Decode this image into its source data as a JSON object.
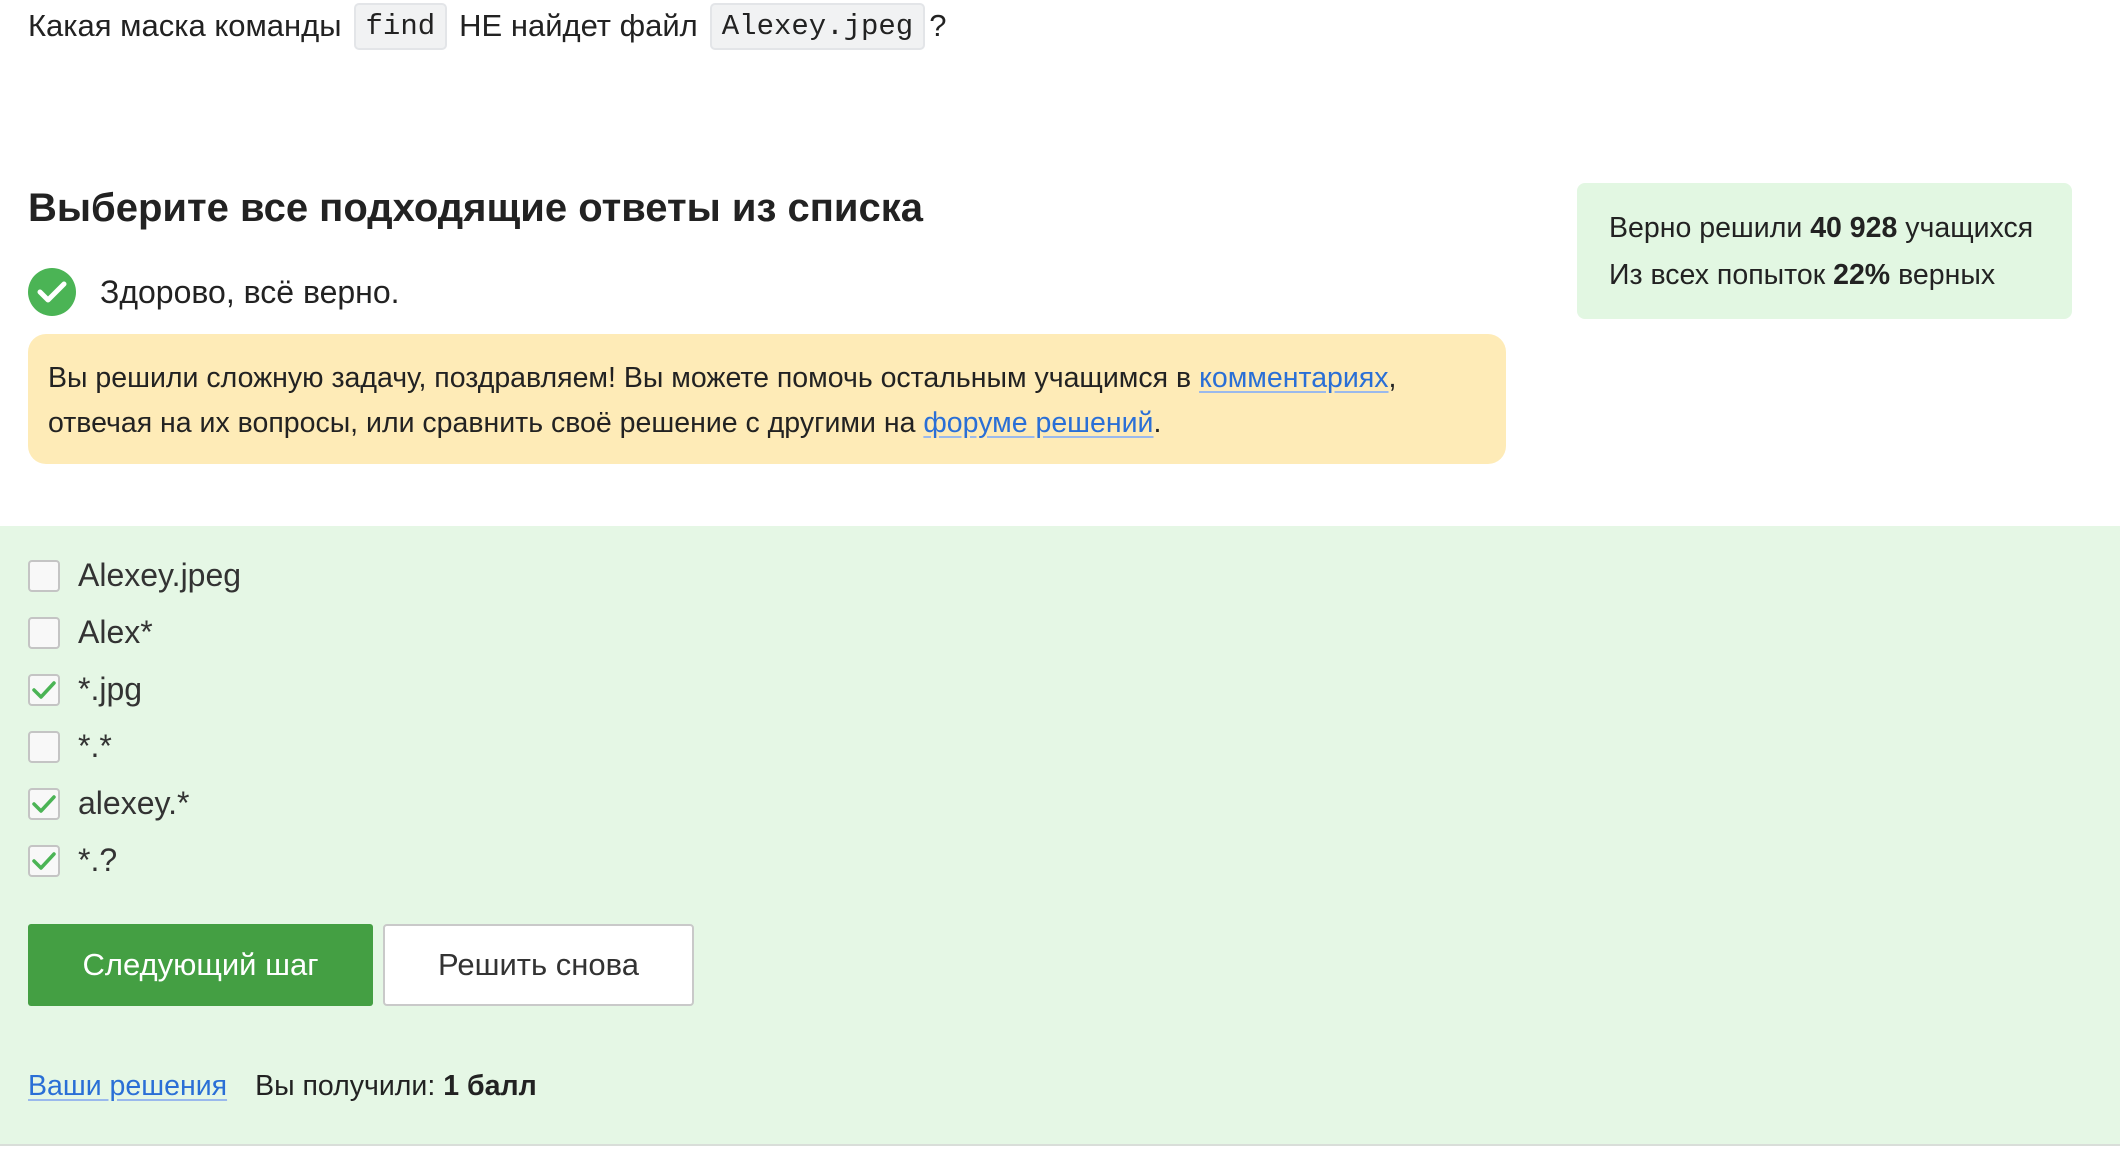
{
  "question": {
    "prefix": "Какая маска команды",
    "command": "find",
    "middle": "НЕ найдет файл",
    "filename": "Alexey.jpeg",
    "suffix": "?"
  },
  "heading": "Выберите все подходящие ответы из списка",
  "success_message": "Здорово, всё верно.",
  "notice": {
    "text_before": "Вы решили сложную задачу, поздравляем! Вы можете помочь остальным учащимся в ",
    "comments_link": "комментариях",
    "text_middle": ", отвечая на их вопросы, или сравнить своё решение с другими на ",
    "forum_link": "форуме решений",
    "text_after": "."
  },
  "stats": {
    "solved_prefix": "Верно решили",
    "solved_count": "40 928",
    "solved_suffix": "учащихся",
    "attempts_prefix": "Из всех попыток",
    "attempts_percent": "22%",
    "attempts_suffix": "верных"
  },
  "options": [
    {
      "label": "Alexey.jpeg",
      "checked": false
    },
    {
      "label": "Alex*",
      "checked": false
    },
    {
      "label": "*.jpg",
      "checked": true
    },
    {
      "label": "*.*",
      "checked": false
    },
    {
      "label": "alexey.*",
      "checked": true
    },
    {
      "label": "*.?",
      "checked": true
    }
  ],
  "buttons": {
    "next": "Следующий шаг",
    "retry": "Решить снова"
  },
  "footer": {
    "solutions_link": "Ваши решения",
    "score_label": "Вы получили:",
    "score_value": "1 балл"
  },
  "colors": {
    "accent_green": "#449f43",
    "success_green": "#4bb455",
    "options_background": "#e5f7e5",
    "notice_background": "#feebb7",
    "link": "#2a6fd6"
  }
}
